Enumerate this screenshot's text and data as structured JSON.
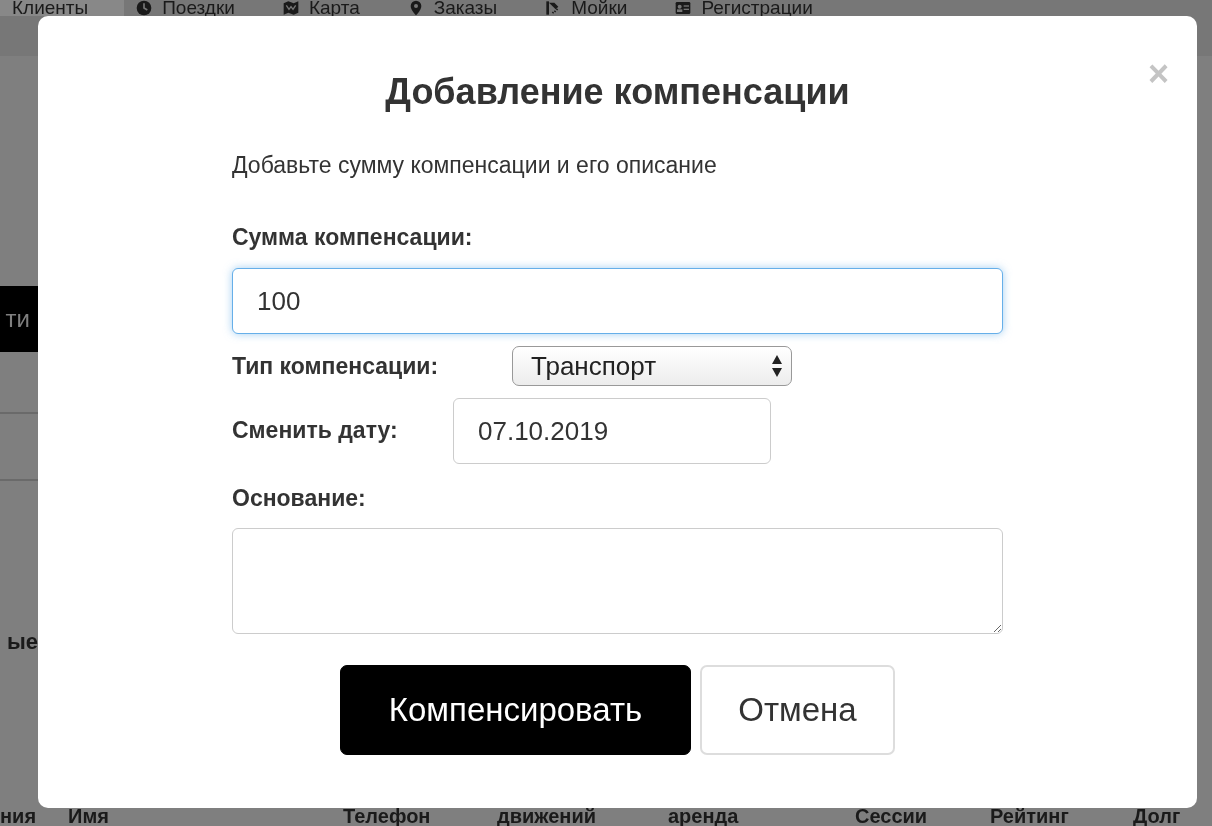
{
  "background": {
    "nav": [
      {
        "label": "Клиенты",
        "selected": true
      },
      {
        "label": "Поездки",
        "selected": false
      },
      {
        "label": "Карта",
        "selected": false
      },
      {
        "label": "Заказы",
        "selected": false
      },
      {
        "label": "Мойки",
        "selected": false
      },
      {
        "label": "Регистрации",
        "selected": false
      }
    ],
    "side_button": "ти",
    "side_label": "ые",
    "table_columns": [
      "ния",
      "Имя",
      "Телефон",
      "движений",
      "аренда",
      "Сессии",
      "Рейтинг",
      "Долг"
    ]
  },
  "modal": {
    "close": "×",
    "title": "Добавление компенсации",
    "description": "Добавьте сумму компенсации и его описание",
    "amount": {
      "label": "Сумма компенсации:",
      "value": "100",
      "focused": true
    },
    "type": {
      "label": "Тип компенсации:",
      "value": "Транспорт"
    },
    "date": {
      "label": "Сменить дату:",
      "value": "07.10.2019"
    },
    "reason": {
      "label": "Основание:"
    },
    "buttons": [
      {
        "label": "Компенсировать",
        "kind": "primary"
      },
      {
        "label": "Отмена",
        "kind": "secondary"
      }
    ]
  }
}
